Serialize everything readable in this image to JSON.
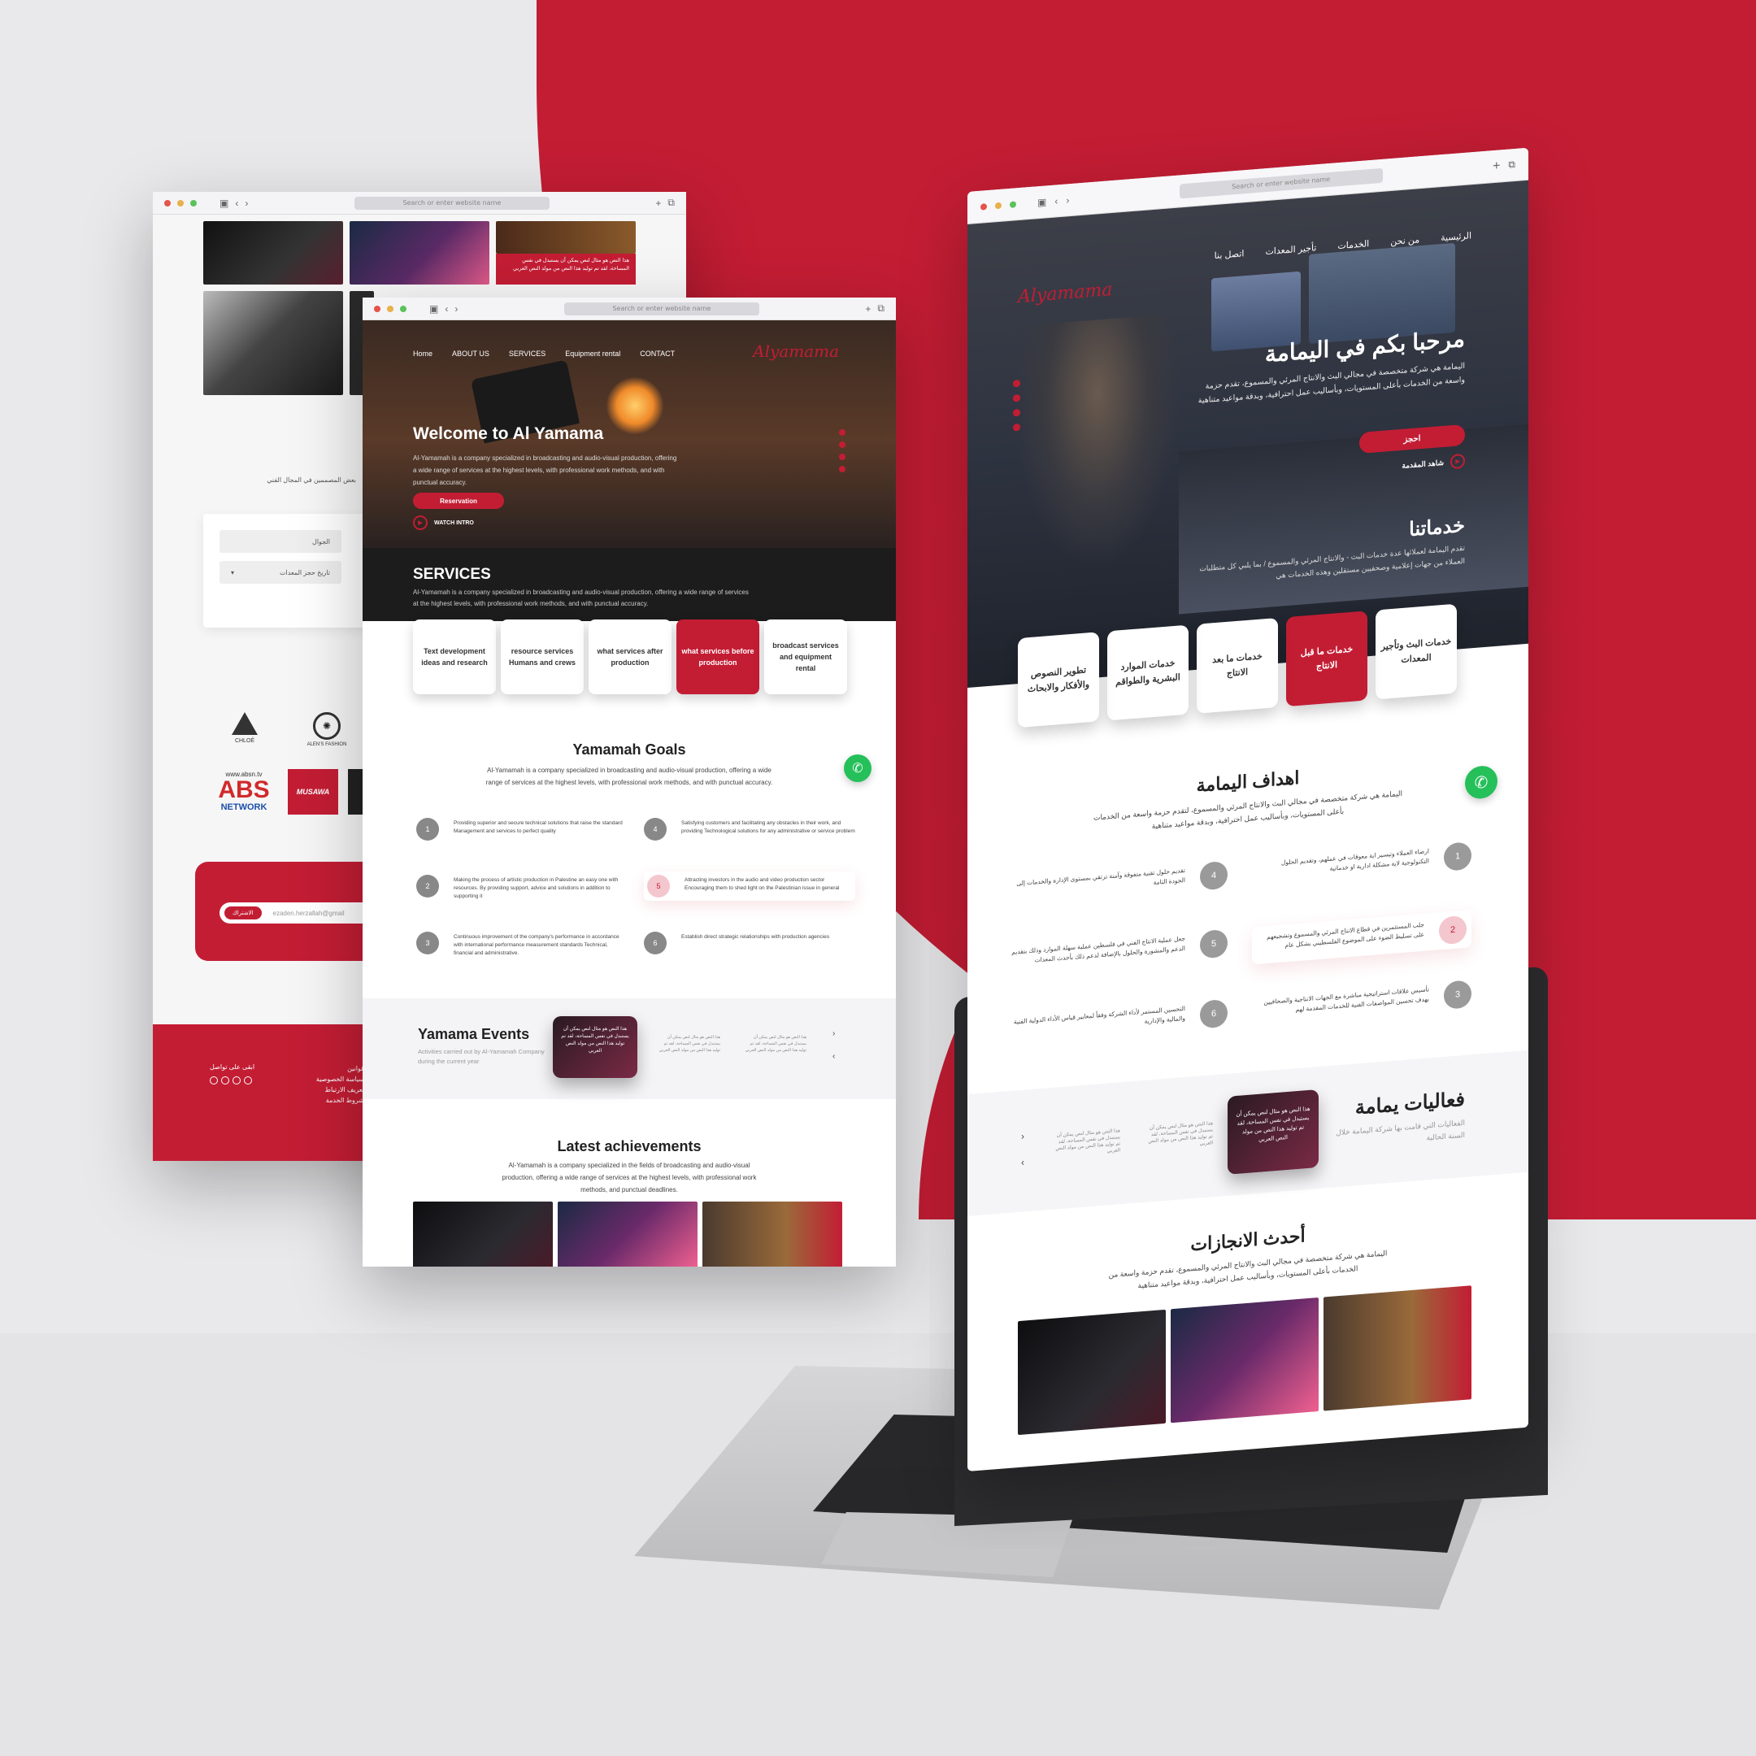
{
  "colors": {
    "brand_red": "#c31d34",
    "whatsapp_green": "#25c05a"
  },
  "browser": {
    "url_placeholder": "Search or enter website name"
  },
  "back_window": {
    "red_card_text": "هذا النص هو مثال لنص يمكن أن يستبدل في نفس المساحة، لقد تم توليد هذا النص من مولد النص العربي",
    "side_text": "بعض المصممين في المجال الفني",
    "form_phone": "الجوال",
    "form_date": "تاريخ حجز المعدات",
    "brand_chloe": "CHLOÉ",
    "brand_fashion": "ALEN'S FASHION",
    "brand_abs_url": "www.absn.tv",
    "brand_abs": "ABS",
    "brand_abs_network": "NETWORK",
    "brand_musawa": "MUSAWA",
    "newsletter_button": "الاشتراك",
    "newsletter_email": "ezaden.herzallah@gmail",
    "footer_contact": "ابقى على تواصل",
    "footer_links_title": "قوانين",
    "footer_link_privacy": "سياسة الخصوصية",
    "footer_link_cookies": "تعريف الارتباط",
    "footer_link_terms": "شروط الخدمة"
  },
  "en_site": {
    "nav": [
      "Home",
      "ABOUT US",
      "SERVICES",
      "Equipment rental",
      "CONTACT"
    ],
    "logo": "Alyamama",
    "hero_title": "Welcome to Al Yamama",
    "hero_text": "Al-Yamamah is a company specialized in broadcasting and audio-visual production, offering a wide range of services at the highest levels, with professional work methods, and with punctual accuracy.",
    "reservation": "Reservation",
    "watch_intro": "WATCH INTRO",
    "services_title": "SERVICES",
    "services_text": "Al-Yamamah is a company specialized in broadcasting and audio-visual production, offering a wide range of services at the highest levels, with professional work methods, and with punctual accuracy.",
    "services": [
      "Text development ideas and research",
      "resource services Humans and crews",
      "what services after production",
      "what services before production",
      "broadcast services and equipment rental"
    ],
    "goals_title": "Yamamah Goals",
    "goals_text": "Al-Yamamah is a company specialized in broadcasting and audio-visual production, offering a wide range of services at the highest levels, with professional work methods, and with punctual accuracy.",
    "goals": [
      {
        "n": "1",
        "t": "Providing superior and secure technical solutions that raise the standard Management and services to perfect quality"
      },
      {
        "n": "2",
        "t": "Making the process of artistic production in Palestine an easy one with resources. By providing support, advice and solutions in addition to supporting it"
      },
      {
        "n": "3",
        "t": "Continuous improvement of the company's performance in accordance with international performance measurement standards Technical, financial and administrative."
      },
      {
        "n": "4",
        "t": "Satisfying customers and facilitating any obstacles in their work, and providing Technological solutions for any administrative or service problem"
      },
      {
        "n": "5",
        "t": "Attracting investors in the audio and video production sector Encouraging them to shed light on the Palestinian issue in general"
      },
      {
        "n": "6",
        "t": "Establish direct strategic relationships with production agencies"
      }
    ],
    "events_title": "Yamama Events",
    "events_text": "Activities carried out by Al-Yamamah Company during the current year",
    "event_card": "هذا النص هو مثال لنص يمكن أن يستبدل في نفس المساحة، لقد تم توليد هذا النص من مولد النص العربي",
    "achievements_title": "Latest achievements",
    "achievements_text": "Al-Yamamah is a company specialized in the fields of broadcasting and audio-visual production, offering a wide range of services at the highest levels, with professional work methods, and punctual deadlines."
  },
  "ar_site": {
    "nav": [
      "الرئيسية",
      "من نحن",
      "الخدمات",
      "تأجير المعدات",
      "اتصل بنا"
    ],
    "logo": "Alyamama",
    "hero_title": "مرحبا بكم في اليمامة",
    "hero_text": "اليمامة هي شركة متخصصة في مجالي البث والانتاج المرئي والمسموع، تقدم حزمة واسعة من الخدمات بأعلى المستويات، وبأساليب عمل احترافية، وبدقة مواعيد متناهية",
    "reservation": "احجز",
    "watch_intro": "شاهد المقدمة",
    "services_title": "خدماتنا",
    "services_text": "تقدم اليمامة لعملائها عدة خدمات البث - والانتاج المرئي والمسموع / بما يلبي كل متطلبات العملاء من جهات إعلامية وصحفيين مستقلين وهذه الخدمات هي",
    "services": [
      "خدمات البث وتأجير المعدات",
      "خدمات ما قبل الانتاج",
      "خدمات ما بعد الانتاج",
      "خدمات الموارد البشرية والطواقم",
      "تطوير النصوص والأفكار والابحاث"
    ],
    "goals_title": "اهداف اليمامة",
    "goals_text": "اليمامة هي شركة متخصصة في مجالي البث والانتاج المرئي والمسموع، لتقدم حزمة واسعة من الخدمات بأعلى المستويات، وبأساليب عمل احترافية، وبدقة مواعيد متناهية",
    "goals": [
      {
        "n": "1",
        "t": "ارضاء العملاء وتيسير اية معوقات في عملهم، وتقديم الحلول التكنولوجية لاية مشكلة ادارية او خدماتية"
      },
      {
        "n": "2",
        "t": "جلب المستثمرين في قطاع الانتاج المرئي والمسموع وتشجيعهم على تسليط الضوء على الموضوع الفلسطيني بشكل عام"
      },
      {
        "n": "3",
        "t": "تأسيس علاقات استراتيجية مباشرة مع الجهات الانتاجية والصحافيين بهدف تحسين المواصفات الفنية للخدمات المقدمة لهم"
      },
      {
        "n": "4",
        "t": "تقديم حلول تقنية متفوقة وآمنة ترتقي بمستوى الإدارة والخدمات إلى الجودة التامة"
      },
      {
        "n": "5",
        "t": "جعل عملية الانتاج الفني في فلسطين عملية سهلة الموارد وذلك بتقديم الدعم والمشورة والحلول بالإضافة لدعم ذلك بأحدث المعدات"
      },
      {
        "n": "6",
        "t": "التحسين المستمر لأداء الشركة وفقاً لمعايير قياس الأداء الدولية الفنية والمالية والإدارية"
      }
    ],
    "events_title": "فعاليات يمامة",
    "events_text": "الفعاليات التي قامت بها شركة اليمامة خلال السنة الحالية",
    "event_card": "هذا النص هو مثال لنص يمكن أن يستبدل في نفس المساحة، لقد تم توليد هذا النص من مولد النص العربي",
    "achievements_title": "أحدث الانجازات",
    "achievements_text": "اليمامة هي شركة متخصصة في مجالي البث والانتاج المرئي والمسموع، تقدم حزمة واسعة من الخدمات بأعلى المستويات، وبأساليب عمل احترافية، وبدقة مواعيد متناهية"
  }
}
